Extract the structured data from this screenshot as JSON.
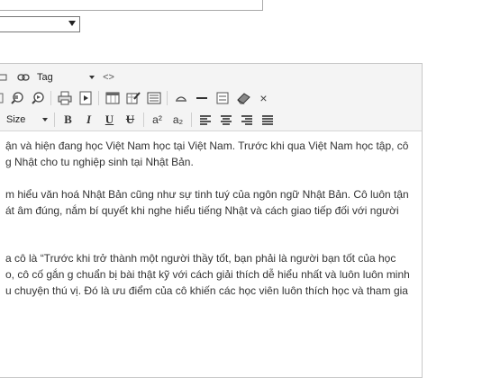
{
  "form": {
    "select_value": ""
  },
  "toolbar": {
    "format_combo": "Tag",
    "code_label": "<>",
    "size_combo": "Size",
    "bold": "B",
    "italic": "I",
    "underline": "U",
    "strike": "U",
    "superscript": "a²",
    "subscript": "a₂",
    "remove_label": "×"
  },
  "content": {
    "para1": [
      "ận và hiện đang học Việt Nam học tại Việt Nam. Trước khi qua Việt Nam học tập, cô",
      "g Nhật cho tu nghiệp sinh tại Nhật Bản."
    ],
    "para2": [
      "m hiểu văn hoá Nhật Bản cũng như sự tinh tuý của ngôn ngữ Nhật Bản. Cô luôn tận",
      "át âm đúng, nắm bí quyết khi nghe hiểu tiếng Nhật và cách giao tiếp đối với người"
    ],
    "para3": [
      "a cô là “Trước khi trở thành một người thầy tốt, bạn phải là người bạn tốt của học",
      "o, cô cố gắn g chuẩn bị bài thật kỹ với cách giải thích dễ hiểu nhất và luôn luôn minh",
      "u chuyện thú vị. Đó là ưu điểm của cô khiến các học viên luôn thích học và tham gia"
    ]
  }
}
